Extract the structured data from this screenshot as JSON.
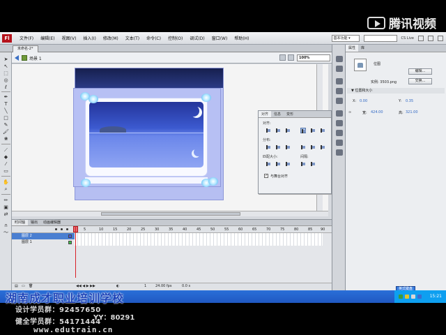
{
  "watermark": "腾讯视频",
  "menu": [
    "文件(F)",
    "编辑(E)",
    "视图(V)",
    "插入(I)",
    "修改(M)",
    "文本(T)",
    "命令(C)",
    "控制(O)",
    "调试(D)",
    "窗口(W)",
    "帮助(H)"
  ],
  "workspace": "基本功能 ▾",
  "cslive": "CS Live",
  "doc_tab": "未命名-2*",
  "scene": "场景 1",
  "zoom": "100%",
  "align_panel": {
    "tabs": [
      "对齐",
      "信息",
      "变形"
    ],
    "labels": [
      "对齐:",
      "分布:",
      "匹配大小:",
      "间隔:"
    ],
    "stage_checkbox": "与舞台对齐",
    "check_mark": "✓"
  },
  "properties": {
    "tabs": [
      "属性",
      "库"
    ],
    "type": "位图",
    "edit_button": "编辑...",
    "instance_label": "实例: 3503.png",
    "swap_button": "交换...",
    "section": "▼ 位置和大小",
    "x_label": "X:",
    "x_value": "0.00",
    "y_label": "Y:",
    "y_value": "0.35",
    "w_label": "宽:",
    "w_value": "424.00",
    "h_label": "高:",
    "h_value": "321.00"
  },
  "timeline": {
    "tabs": [
      "时间轴",
      "输出",
      "动画编辑器"
    ],
    "frame_numbers": [
      "5",
      "10",
      "15",
      "20",
      "25",
      "30",
      "35",
      "40",
      "45",
      "50",
      "55",
      "60",
      "65",
      "70",
      "75",
      "80",
      "85",
      "90"
    ],
    "layers": [
      "图层 2",
      "图层 1"
    ],
    "status_frame": "1",
    "status_fps": "24.00 fps",
    "status_time": "0.0 s"
  },
  "taskbar": {
    "ime": "英式键盘",
    "clock": "15:21"
  },
  "school": {
    "name": "湖南成才职业培训学校",
    "line1": "设计学员群：92457650",
    "line2": "健全学员群：54171444",
    "yy": "YY：80291",
    "url": "www.edutrain.cn"
  },
  "colors": {
    "taskbar": "#1f58c2",
    "school_name": "#1d43b8",
    "artboard": "#b6bff2"
  }
}
